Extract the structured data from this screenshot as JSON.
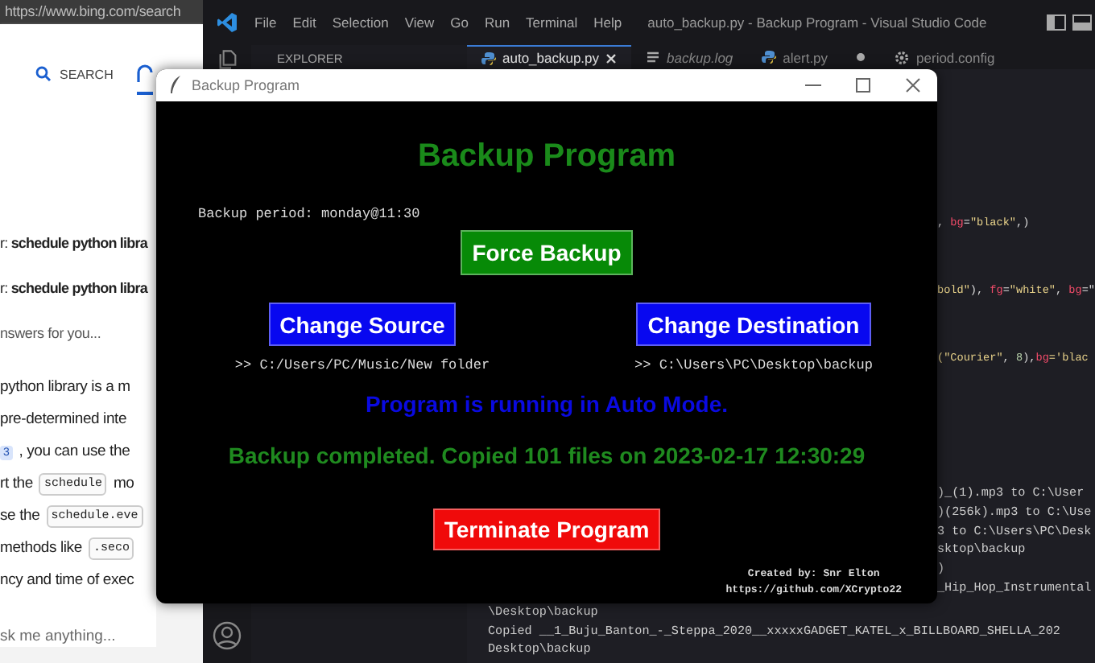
{
  "browser": {
    "url": "https://www.bing.com/search",
    "tabs": [
      {
        "kind": "search",
        "label": "SEARCH",
        "selected": false
      },
      {
        "kind": "chat",
        "selected": true
      }
    ],
    "lines": [
      {
        "kind": "text",
        "parts": [
          {
            "text": "r: **schedule python libra**"
          }
        ]
      },
      {
        "kind": "text",
        "parts": [
          {
            "text": "r: **schedule python libra**"
          }
        ]
      },
      {
        "kind": "note",
        "parts": [
          {
            "text": "nswers for you..."
          }
        ]
      },
      {
        "kind": "body",
        "parts": [
          {
            "text": "python library is a m"
          }
        ]
      },
      {
        "kind": "body",
        "parts": [
          {
            "text": "pre-determined inte"
          }
        ]
      },
      {
        "kind": "body",
        "parts": [
          {
            "text": "3",
            "kind": "cite"
          },
          {
            "text": ", you can use the"
          }
        ]
      },
      {
        "kind": "body",
        "parts": [
          {
            "text": "rt the"
          },
          {
            "text": "schedule",
            "kind": "code"
          },
          {
            "text": "mo"
          }
        ]
      },
      {
        "kind": "body",
        "parts": [
          {
            "text": "se the"
          },
          {
            "text": "schedule.eve",
            "kind": "code"
          }
        ]
      },
      {
        "kind": "body",
        "parts": [
          {
            "text": "methods like"
          },
          {
            "text": ".seco",
            "kind": "code"
          }
        ]
      },
      {
        "kind": "body",
        "parts": [
          {
            "text": "ncy and time of exec"
          }
        ]
      }
    ],
    "prompt": {
      "placeholder": "sk me anything..."
    }
  },
  "editor": {
    "menu": [
      "File",
      "Edit",
      "Selection",
      "View",
      "Go",
      "Run",
      "Terminal",
      "Help"
    ],
    "title": "auto_backup.py - Backup Program - Visual Studio Code",
    "explorer": "EXPLORER",
    "tabs": [
      {
        "kind": "python",
        "label": "auto_backup.py",
        "selected": true,
        "modified": false
      },
      {
        "kind": "log",
        "label": "backup.log",
        "selected": false,
        "modified": false
      },
      {
        "kind": "python",
        "label": "alert.py",
        "selected": false,
        "modified": true
      },
      {
        "kind": "config",
        "label": "period.config",
        "selected": false,
        "modified": false
      }
    ],
    "code_lines": [
      [
        {
          "text": ", ",
          "kind": "plain"
        },
        {
          "text": "bg",
          "kind": "param"
        },
        {
          "text": "=",
          "kind": "plain"
        },
        {
          "text": "\"black\"",
          "kind": "string"
        },
        {
          "text": ",)",
          "kind": "plain"
        }
      ],
      [
        {
          "text": "bold\"",
          "kind": "string"
        },
        {
          "text": "), ",
          "kind": "plain"
        },
        {
          "text": "fg",
          "kind": "param"
        },
        {
          "text": "=",
          "kind": "plain"
        },
        {
          "text": "\"white\"",
          "kind": "string"
        },
        {
          "text": ", ",
          "kind": "plain"
        },
        {
          "text": "bg",
          "kind": "param"
        },
        {
          "text": "=\"",
          "kind": "plain"
        }
      ],
      [
        {
          "text": "(\"Courier\"",
          "kind": "string"
        },
        {
          "text": ", ",
          "kind": "plain"
        },
        {
          "text": "8",
          "kind": "number"
        },
        {
          "text": "),",
          "kind": "plain"
        },
        {
          "text": "bg",
          "kind": "param"
        },
        {
          "text": "='blac",
          "kind": "string"
        }
      ]
    ],
    "terminal_right": [
      ")_(1).mp3 to C:\\User",
      ")(256k).mp3 to C:\\Use",
      "3 to C:\\Users\\PC\\Desk",
      "sktop\\backup",
      ")",
      "_Hip_Hop_Instrumental"
    ],
    "terminal_bottom": [
      "\\Desktop\\backup",
      "Copied __1_Buju_Banton_-_Steppa_2020__xxxxxGADGET_KATEL_x_BILLBOARD_SHELLA_202",
      "Desktop\\backup"
    ]
  },
  "app": {
    "title": "Backup Program",
    "heading": "Backup Program",
    "period": "Backup period: monday@11:30",
    "force_button": {
      "label": "Force Backup",
      "color": "#078a07"
    },
    "source": {
      "button": {
        "label": "Change Source",
        "color": "#0808f0"
      },
      "path": ">> C:/Users/PC/Music/New folder"
    },
    "destination": {
      "button": {
        "label": "Change Destination",
        "color": "#0808f0"
      },
      "path": ">> C:\\Users\\PC\\Desktop\\backup"
    },
    "status": "Program is running in Auto Mode.",
    "last_backup": "Backup completed. Copied 101 files on 2023-02-17 12:30:29",
    "terminate_button": {
      "label": "Terminate Program",
      "color": "#f00a0a"
    },
    "credits": [
      "Created by: Snr Elton",
      "https://github.com/XCrypto22"
    ]
  }
}
